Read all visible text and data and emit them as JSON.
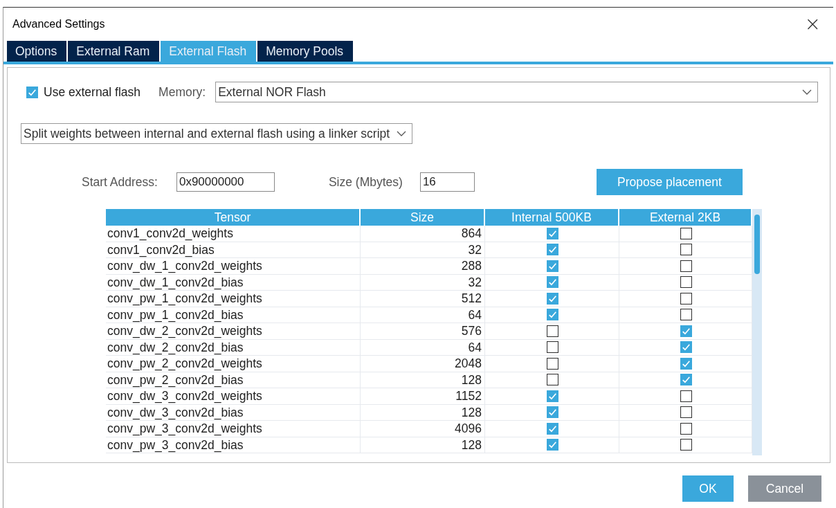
{
  "window": {
    "title": "Advanced Settings",
    "close": "×"
  },
  "tabs": [
    {
      "label": "Options",
      "selected": false
    },
    {
      "label": "External Ram",
      "selected": false
    },
    {
      "label": "External Flash",
      "selected": true
    },
    {
      "label": "Memory Pools",
      "selected": false
    }
  ],
  "use_external_flash": {
    "label": "Use external flash",
    "checked": true
  },
  "memory": {
    "label": "Memory:",
    "value": "External NOR Flash"
  },
  "mode": {
    "value": "Split weights between internal and external flash using a linker script"
  },
  "start_address": {
    "label": "Start Address:",
    "value": "0x90000000"
  },
  "size": {
    "label": "Size (Mbytes)",
    "value": "16"
  },
  "propose_button": "Propose placement",
  "table": {
    "columns": [
      "Tensor",
      "Size",
      "Internal 500KB",
      "External 2KB"
    ],
    "rows": [
      {
        "tensor": "conv1_conv2d_weights",
        "size": "864",
        "internal": true,
        "external": false
      },
      {
        "tensor": "conv1_conv2d_bias",
        "size": "32",
        "internal": true,
        "external": false
      },
      {
        "tensor": "conv_dw_1_conv2d_weights",
        "size": "288",
        "internal": true,
        "external": false
      },
      {
        "tensor": "conv_dw_1_conv2d_bias",
        "size": "32",
        "internal": true,
        "external": false
      },
      {
        "tensor": "conv_pw_1_conv2d_weights",
        "size": "512",
        "internal": true,
        "external": false
      },
      {
        "tensor": "conv_pw_1_conv2d_bias",
        "size": "64",
        "internal": true,
        "external": false
      },
      {
        "tensor": "conv_dw_2_conv2d_weights",
        "size": "576",
        "internal": false,
        "external": true
      },
      {
        "tensor": "conv_dw_2_conv2d_bias",
        "size": "64",
        "internal": false,
        "external": true
      },
      {
        "tensor": "conv_pw_2_conv2d_weights",
        "size": "2048",
        "internal": false,
        "external": true
      },
      {
        "tensor": "conv_pw_2_conv2d_bias",
        "size": "128",
        "internal": false,
        "external": true
      },
      {
        "tensor": "conv_dw_3_conv2d_weights",
        "size": "1152",
        "internal": true,
        "external": false
      },
      {
        "tensor": "conv_dw_3_conv2d_bias",
        "size": "128",
        "internal": true,
        "external": false
      },
      {
        "tensor": "conv_pw_3_conv2d_weights",
        "size": "4096",
        "internal": true,
        "external": false
      },
      {
        "tensor": "conv_pw_3_conv2d_bias",
        "size": "128",
        "internal": true,
        "external": false
      }
    ]
  },
  "buttons": [
    {
      "label": "OK",
      "kind": "primary"
    },
    {
      "label": "Cancel",
      "kind": "secondary"
    }
  ]
}
